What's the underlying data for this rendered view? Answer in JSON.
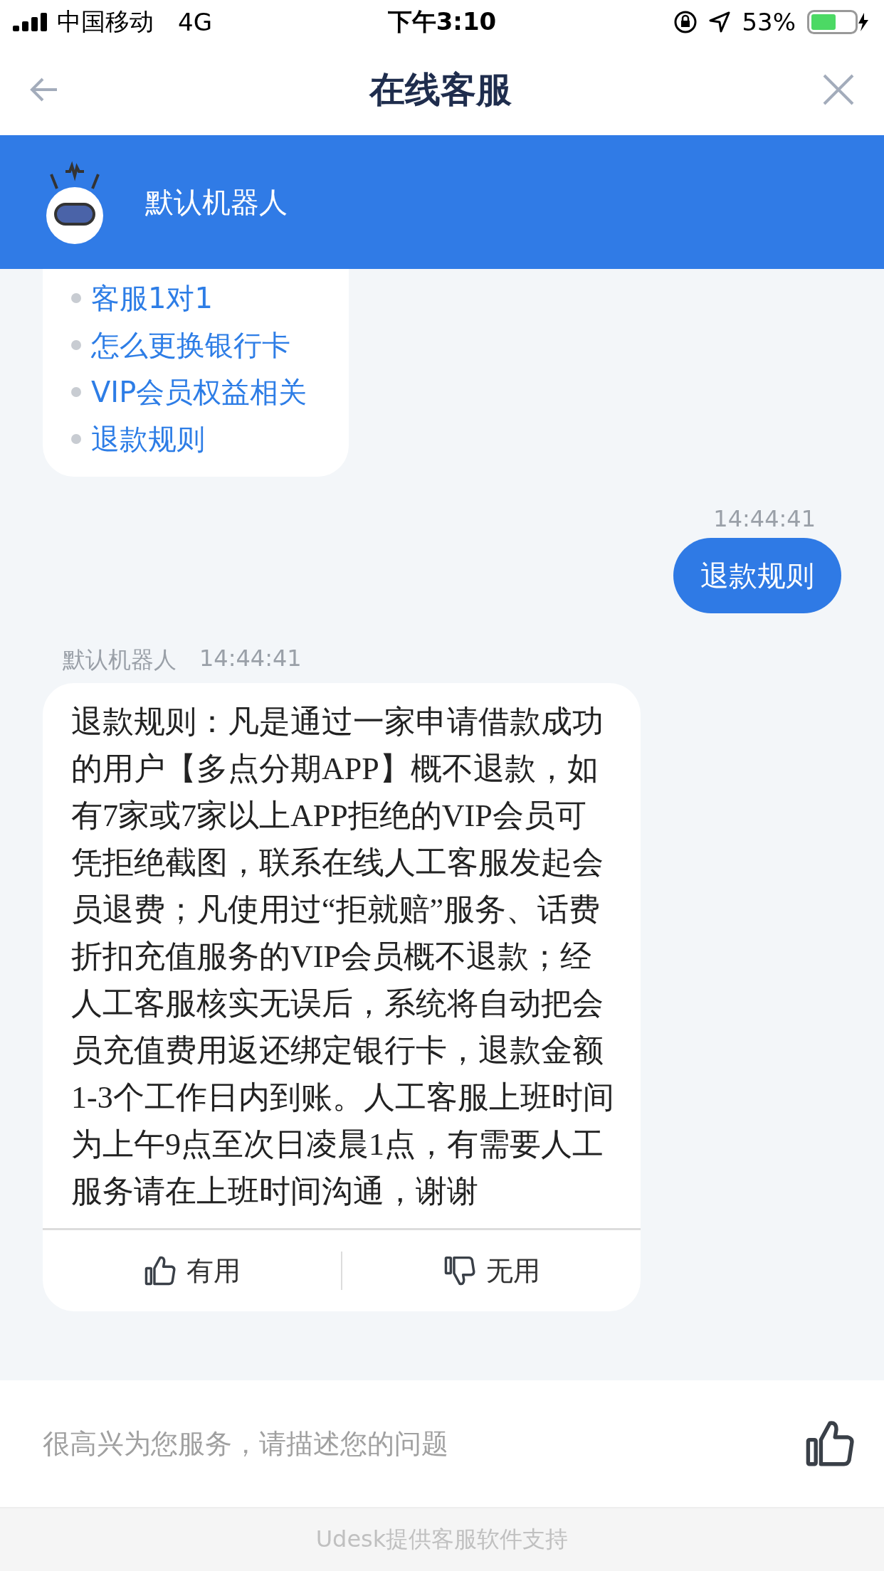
{
  "status_bar": {
    "carrier": "中国移动",
    "network": "4G",
    "time": "下午3:10",
    "battery": "53%"
  },
  "nav": {
    "title": "在线客服"
  },
  "agent_bar": {
    "name": "默认机器人"
  },
  "messages": [
    {
      "kind": "menu",
      "items": [
        "客服1对1",
        "怎么更换银行卡",
        "VIP会员权益相关",
        "退款规则"
      ]
    },
    {
      "kind": "user",
      "time": "14:44:41",
      "text": "退款规则"
    },
    {
      "kind": "bot",
      "sender": "默认机器人",
      "time": "14:44:41",
      "text": "退款规则：凡是通过一家申请借款成功的用户【多点分期APP】概不退款，如有7家或7家以上APP拒绝的VIP会员可凭拒绝截图，联系在线人工客服发起会员退费；凡使用过“拒就赔”服务、话费折扣充值服务的VIP会员概不退款；经人工客服核实无误后，系统将自动把会员充值费用返还绑定银行卡，退款金额1-3个工作日内到账。人工客服上班时间为上午9点至次日凌晨1点，有需要人工服务请在上班时间沟通，谢谢",
      "feedback": [
        {
          "kind": "up",
          "label": "有用"
        },
        {
          "kind": "down",
          "label": "无用"
        }
      ]
    }
  ],
  "input": {
    "placeholder": "很高兴为您服务，请描述您的问题"
  },
  "footer": {
    "text": "Udesk提供客服软件支持"
  }
}
